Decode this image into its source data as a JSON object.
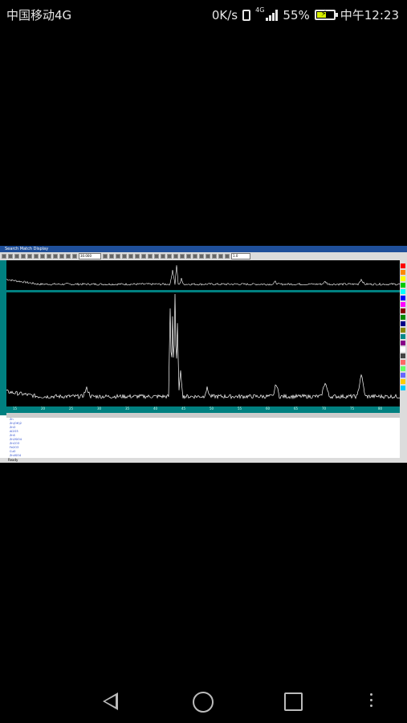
{
  "status_bar": {
    "carrier": "中国移动4G",
    "net_speed": "0K/s",
    "net_type": "4G",
    "battery_pct": "55%",
    "battery_level": 0.55,
    "time": "中午12:23"
  },
  "app": {
    "title": "Search Match Display",
    "toolbar_field_1": "30.000",
    "toolbar_field_2": "1.0",
    "axis_ticks": [
      "15",
      "20",
      "25",
      "30",
      "35",
      "40",
      "45",
      "50",
      "55",
      "60",
      "65",
      "70",
      "75",
      "80"
    ],
    "table_rows": [
      "Zn",
      "Zn(OH)2",
      "ZnO",
      "Al2O3",
      "ZnS",
      "Zn2SiO4",
      "ZnCO3",
      "Fe2O3",
      "CuO",
      "Zn4SO4"
    ],
    "status_text": "Ready"
  },
  "colors": {
    "titlebar": "#1f4f9a",
    "teal": "#008080",
    "spectrum": "#ffffff",
    "battery_fill": "#d8f000"
  },
  "nav": {
    "back_icon": "back-icon",
    "home_icon": "home-icon",
    "recent_icon": "recent-apps-icon",
    "menu_icon": "more-icon"
  }
}
